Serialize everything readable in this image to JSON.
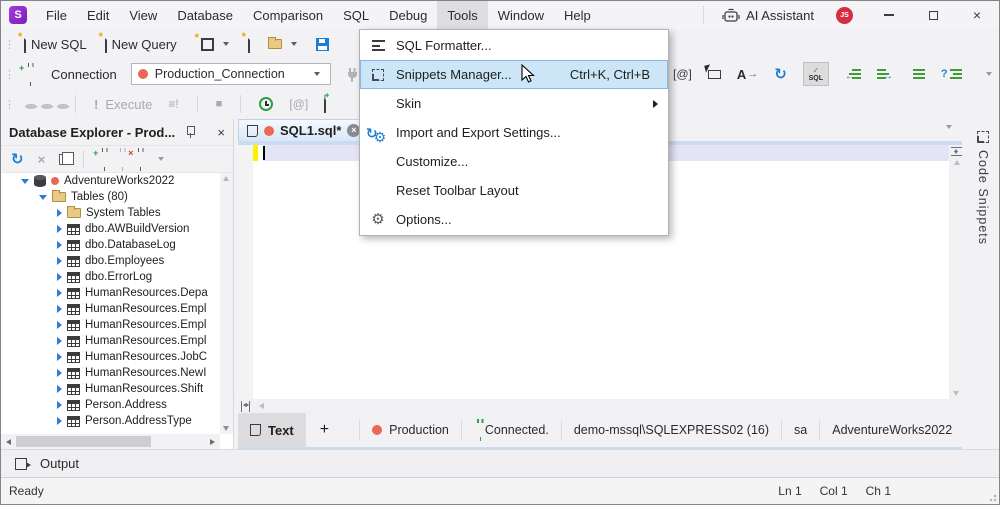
{
  "app": {
    "logo_letter": "S"
  },
  "menubar": {
    "items": [
      "File",
      "Edit",
      "View",
      "Database",
      "Comparison",
      "SQL",
      "Debug",
      "Tools",
      "Window",
      "Help"
    ],
    "active": "Tools"
  },
  "titlebar": {
    "ai_assistant": "AI Assistant",
    "avatar": "JS"
  },
  "toolbar_standard": {
    "new_sql": "New SQL",
    "new_query": "New Query"
  },
  "toolbar_connection": {
    "label": "Connection",
    "value": "Production_Connection"
  },
  "toolbar_execute": {
    "execute_label": "Execute"
  },
  "tools_menu": {
    "items": [
      {
        "label": "SQL Formatter...",
        "shortcut": ""
      },
      {
        "label": "Snippets Manager...",
        "shortcut": "Ctrl+K, Ctrl+B"
      },
      {
        "label": "Skin",
        "shortcut": ""
      },
      {
        "label": "Import and Export Settings...",
        "shortcut": ""
      },
      {
        "label": "Customize...",
        "shortcut": ""
      },
      {
        "label": "Reset Toolbar Layout",
        "shortcut": ""
      },
      {
        "label": "Options...",
        "shortcut": ""
      }
    ]
  },
  "explorer": {
    "title": "Database Explorer - Prod...",
    "tree": [
      {
        "label": "AdventureWorks2022"
      },
      {
        "label": "Tables (80)"
      },
      {
        "label": "System Tables"
      },
      {
        "label": "dbo.AWBuildVersion"
      },
      {
        "label": "dbo.DatabaseLog"
      },
      {
        "label": "dbo.Employees"
      },
      {
        "label": "dbo.ErrorLog"
      },
      {
        "label": "HumanResources.Depa"
      },
      {
        "label": "HumanResources.Empl"
      },
      {
        "label": "HumanResources.Empl"
      },
      {
        "label": "HumanResources.Empl"
      },
      {
        "label": "HumanResources.JobC"
      },
      {
        "label": "HumanResources.NewI"
      },
      {
        "label": "HumanResources.Shift"
      },
      {
        "label": "Person.Address"
      },
      {
        "label": "Person.AddressType"
      }
    ]
  },
  "editor": {
    "tab_title": "SQL1.sql*",
    "code_snippets_tab": "Code Snippets"
  },
  "bottom_bar": {
    "text_tab": "Text",
    "connection_name": "Production",
    "connection_status": "Connected.",
    "server": "demo-mssql\\SQLEXPRESS02 (16)",
    "user": "sa",
    "database": "AdventureWorks2022"
  },
  "output_panel": {
    "label": "Output"
  },
  "statusbar": {
    "state": "Ready",
    "line": "Ln 1",
    "column": "Col 1",
    "char": "Ch 1"
  },
  "icons": {
    "grip": "⋮",
    "refresh": "↻",
    "at": "[@]",
    "a_letter": "A",
    "check": "✓",
    "sql": "SQL",
    "exclaim": "!",
    "stop": "■",
    "gear": "⚙",
    "plus": "+",
    "lines_exclaim": "≡!",
    "question": "?",
    "arrow": "→",
    "star": "*",
    "camera": "[@]",
    "close": "×"
  },
  "colors": {
    "accent_blue": "#1b7fd4",
    "menu_highlight": "#cde6f7",
    "status_red": "#eb6852",
    "connected_green": "#2f9e44",
    "change_bar_yellow": "#ffef00"
  }
}
